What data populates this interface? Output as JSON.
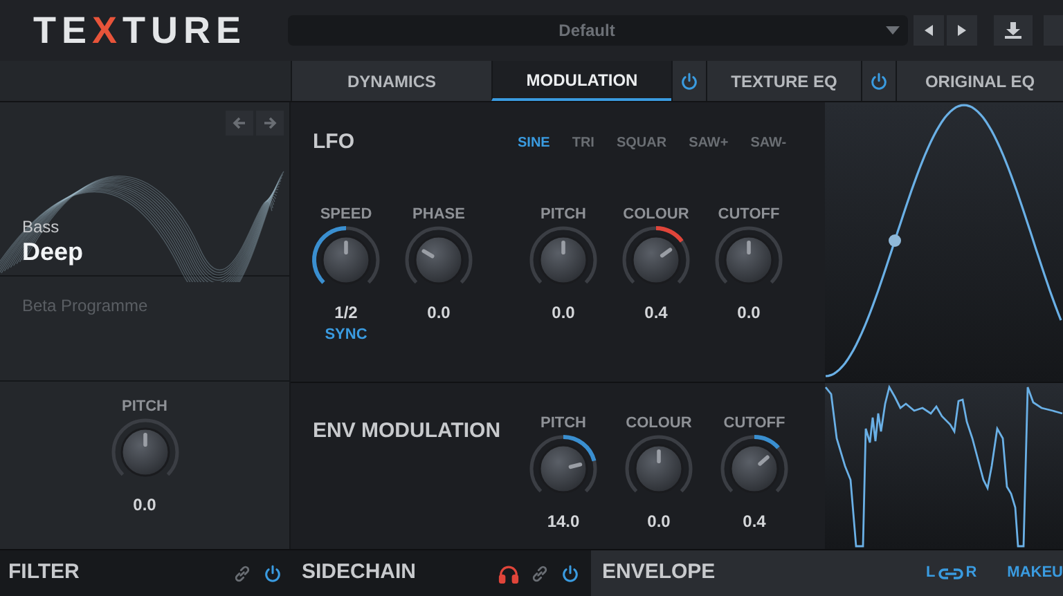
{
  "logo": [
    {
      "text": "TE",
      "accent": false
    },
    {
      "text": "X",
      "accent": true
    },
    {
      "text": "TURE",
      "accent": false
    }
  ],
  "preset": {
    "value": "Default"
  },
  "tabs": [
    {
      "kind": "tab",
      "label": "DYNAMICS",
      "selected": false
    },
    {
      "kind": "tab",
      "label": "MODULATION",
      "selected": true
    },
    {
      "kind": "power",
      "on": true
    },
    {
      "kind": "tab",
      "label": "TEXTURE EQ",
      "selected": false
    },
    {
      "kind": "power",
      "on": true
    },
    {
      "kind": "tab",
      "label": "ORIGINAL EQ",
      "selected": false
    }
  ],
  "sidebar": {
    "category": "Bass",
    "name": "Deep",
    "note": "Beta Programme",
    "knob": {
      "label": "PITCH",
      "value": "0.0",
      "level": 0.5
    }
  },
  "lfo": {
    "title": "LFO",
    "shapes": [
      {
        "label": "SINE",
        "selected": true
      },
      {
        "label": "TRI",
        "selected": false
      },
      {
        "label": "SQUAR",
        "selected": false
      },
      {
        "label": "SAW+",
        "selected": false
      },
      {
        "label": "SAW-",
        "selected": false
      }
    ],
    "knobs": [
      {
        "label": "SPEED",
        "value": "1/2",
        "sync": "SYNC",
        "level": 0.5,
        "kind": "unipolar",
        "color": "#3a8fd0"
      },
      {
        "label": "PHASE",
        "value": "0.0",
        "level": 0.28,
        "kind": "plain"
      },
      {
        "label": "PITCH",
        "value": "0.0",
        "level": 0.5,
        "kind": "plain"
      },
      {
        "label": "COLOUR",
        "value": "0.4",
        "level": 0.7,
        "kind": "bipolar",
        "color": "#e0453a"
      },
      {
        "label": "CUTOFF",
        "value": "0.0",
        "level": 0.5,
        "kind": "plain"
      }
    ]
  },
  "env_modulation": {
    "title": "ENV MODULATION",
    "knobs": [
      {
        "label": "PITCH",
        "value": "14.0",
        "level": 0.78,
        "kind": "bipolar",
        "color": "#3a8fd0"
      },
      {
        "label": "COLOUR",
        "value": "0.0",
        "level": 0.5,
        "kind": "plain"
      },
      {
        "label": "CUTOFF",
        "value": "0.4",
        "level": 0.68,
        "kind": "bipolar",
        "color": "#3a8fd0"
      }
    ]
  },
  "bottom": {
    "filter": {
      "title": "FILTER",
      "on": true
    },
    "sidechain": {
      "title": "SIDECHAIN",
      "listen": true,
      "on": true
    },
    "envelope": {
      "title": "ENVELOPE",
      "left": "L",
      "right": "R",
      "makeup": "MAKEU"
    }
  }
}
